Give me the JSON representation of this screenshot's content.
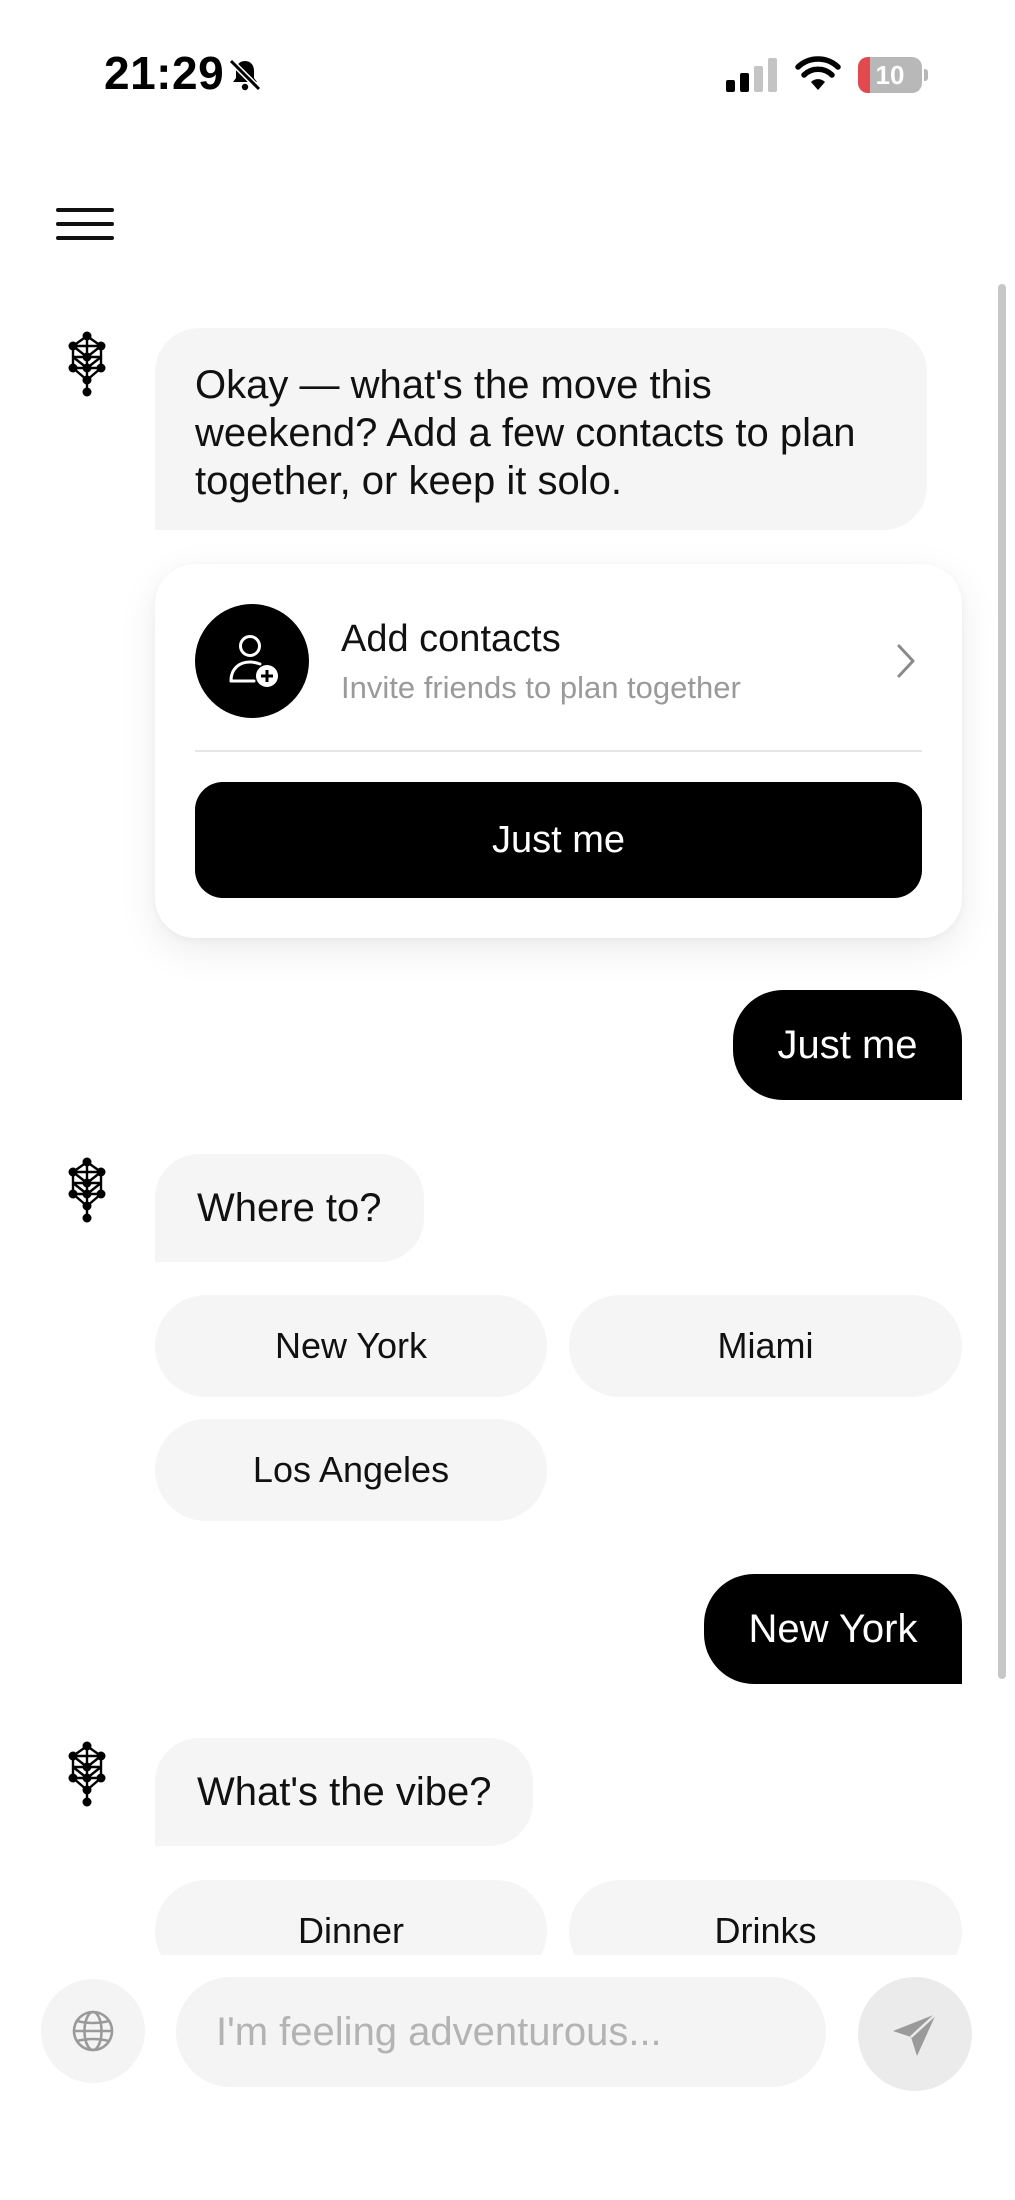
{
  "status_bar": {
    "time": "21:29",
    "battery_level": "10",
    "battery_fraction": 0.1,
    "bell_icon": "bell-slash-icon",
    "signal_icon": "cellular-signal-icon",
    "wifi_icon": "wifi-icon"
  },
  "header": {
    "menu_icon": "hamburger-menu-icon"
  },
  "chat": {
    "bot_avatar_icon": "tree-of-life-icon",
    "messages": [
      {
        "role": "assistant",
        "text": "Okay — what's the move this weekend? Add a few contacts to plan together, or keep it solo."
      },
      {
        "role": "user",
        "text": "Just me"
      },
      {
        "role": "assistant",
        "text": "Where to?"
      },
      {
        "role": "user",
        "text": "New York"
      },
      {
        "role": "assistant",
        "text": "What's the vibe?"
      }
    ],
    "contact_card": {
      "title": "Add contacts",
      "subtitle": "Invite friends to plan together",
      "icon": "add-person-icon",
      "chevron": "chevron-right-icon",
      "button_label": "Just me"
    },
    "location_options": [
      "New York",
      "Miami",
      "Los Angeles"
    ],
    "vibe_options": [
      "Dinner",
      "Drinks"
    ]
  },
  "input_bar": {
    "placeholder": "I'm feeling adventurous...",
    "value": "",
    "globe_icon": "globe-icon",
    "send_icon": "send-paper-plane-icon"
  },
  "colors": {
    "primary": "#000000",
    "bubble_background": "#f5f5f5",
    "muted_text": "#9a9a9a",
    "battery_low": "#e5484d"
  }
}
